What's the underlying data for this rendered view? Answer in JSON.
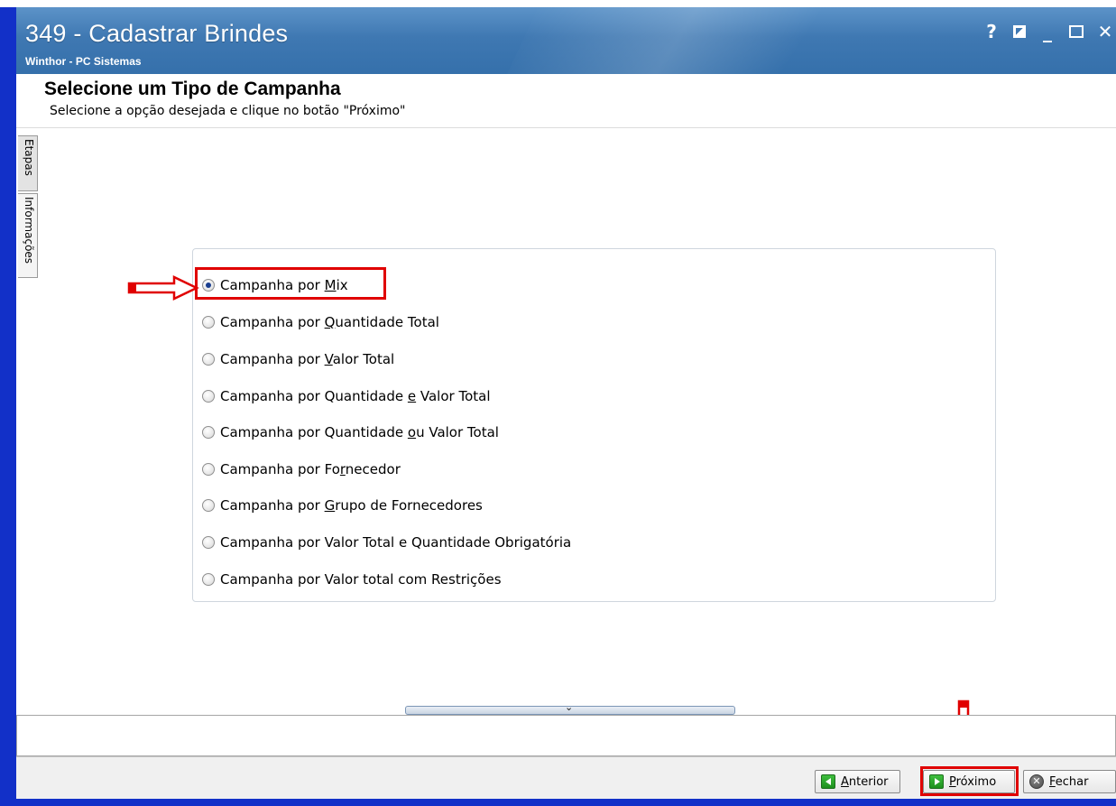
{
  "window": {
    "title": "349 - Cadastrar Brindes",
    "subtitle": "Winthor - PC Sistemas",
    "controls": {
      "help": "?",
      "minimize": "_"
    }
  },
  "header": {
    "heading": "Selecione um Tipo de Campanha",
    "instruction": "Selecione a opção desejada e clique no botão \"Próximo\""
  },
  "side_tabs": {
    "etapas": "Etapas",
    "informacoes": "Informações"
  },
  "options": [
    {
      "before": "Campanha por ",
      "key": "M",
      "after": "ix",
      "checked": true
    },
    {
      "before": "Campanha por ",
      "key": "Q",
      "after": "uantidade Total",
      "checked": false
    },
    {
      "before": "Campanha por ",
      "key": "V",
      "after": "alor Total",
      "checked": false
    },
    {
      "before": "Campanha por Quantidade ",
      "key": "e",
      "after": " Valor Total",
      "checked": false
    },
    {
      "before": "Campanha por Quantidade ",
      "key": "o",
      "after": "u Valor Total",
      "checked": false
    },
    {
      "before": "Campanha por Fo",
      "key": "r",
      "after": "necedor",
      "checked": false
    },
    {
      "before": "Campanha por ",
      "key": "G",
      "after": "rupo de Fornecedores",
      "checked": false
    },
    {
      "before": "Campanha por Valor Total e Quantidade Obrigatória",
      "key": "",
      "after": "",
      "checked": false
    },
    {
      "before": "Campanha por Valor total com Restrições",
      "key": "",
      "after": "",
      "checked": false
    }
  ],
  "splitter": {
    "icon": "⌄"
  },
  "footer": {
    "anterior": {
      "key": "A",
      "rest": "nterior"
    },
    "proximo": {
      "key": "P",
      "rest": "róximo"
    },
    "fechar": {
      "key": "F",
      "rest": "echar"
    }
  },
  "colors": {
    "titlebar": "#3f78b2",
    "frame": "#1230c8",
    "highlight": "#e00000"
  }
}
